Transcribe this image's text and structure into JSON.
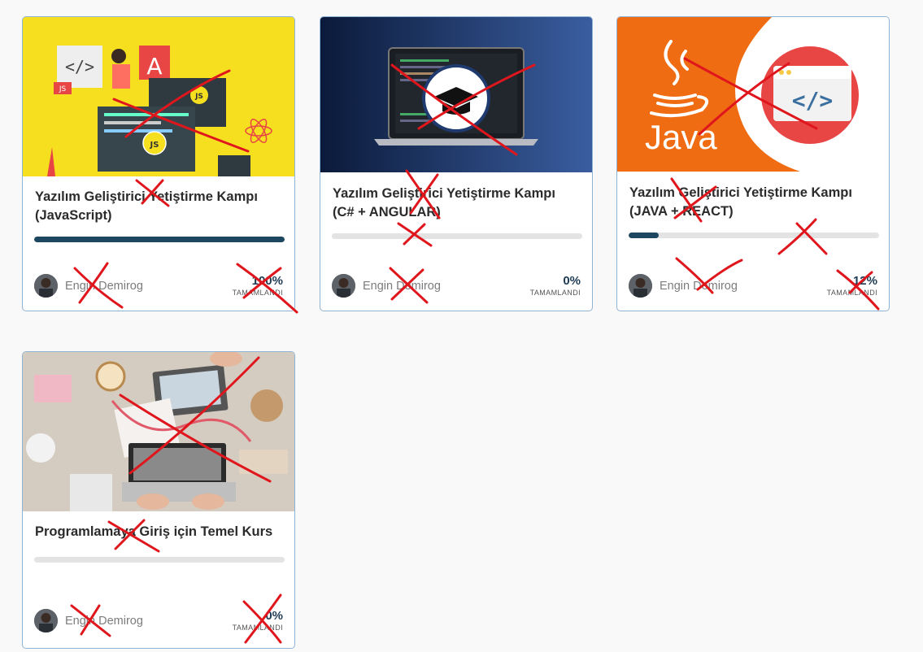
{
  "courses": [
    {
      "title": "Yazılım Geliştirici Yetiştirme Kampı (JavaScript)",
      "instructor": "Engin Demirog",
      "percent": "100%",
      "progress": 100,
      "completion_label": "TAMAMLANDI",
      "thumbnail_icons": [
        "js-badge-icon",
        "angular-icon",
        "react-icon",
        "code-icon"
      ]
    },
    {
      "title": "Yazılım Geliştirici Yetiştirme Kampı (C# + ANGULAR)",
      "instructor": "Engin Demirog",
      "percent": "0%",
      "progress": 0,
      "completion_label": "TAMAMLANDI",
      "thumbnail_icons": [
        "laptop-icon",
        "graduation-cap-icon"
      ]
    },
    {
      "title": "Yazılım Geliştirici Yetiştirme Kampı (JAVA + REACT)",
      "instructor": "Engin Demirog",
      "percent": "12%",
      "progress": 12,
      "completion_label": "TAMAMLANDI",
      "thumbnail_text": "Java",
      "thumbnail_icons": [
        "java-cup-icon",
        "code-window-icon"
      ]
    },
    {
      "title": "Programlamaya Giriş için Temel Kurs",
      "instructor": "Engin Demirog",
      "percent": "0%",
      "progress": 0,
      "completion_label": "TAMAMLANDI",
      "thumbnail_icons": [
        "desk-photo"
      ]
    }
  ],
  "colors": {
    "progress_fill": "#1d4761",
    "progress_track": "#e3e3e3",
    "card_border": "#8fb3d4",
    "annotation_red": "#e0161d"
  }
}
